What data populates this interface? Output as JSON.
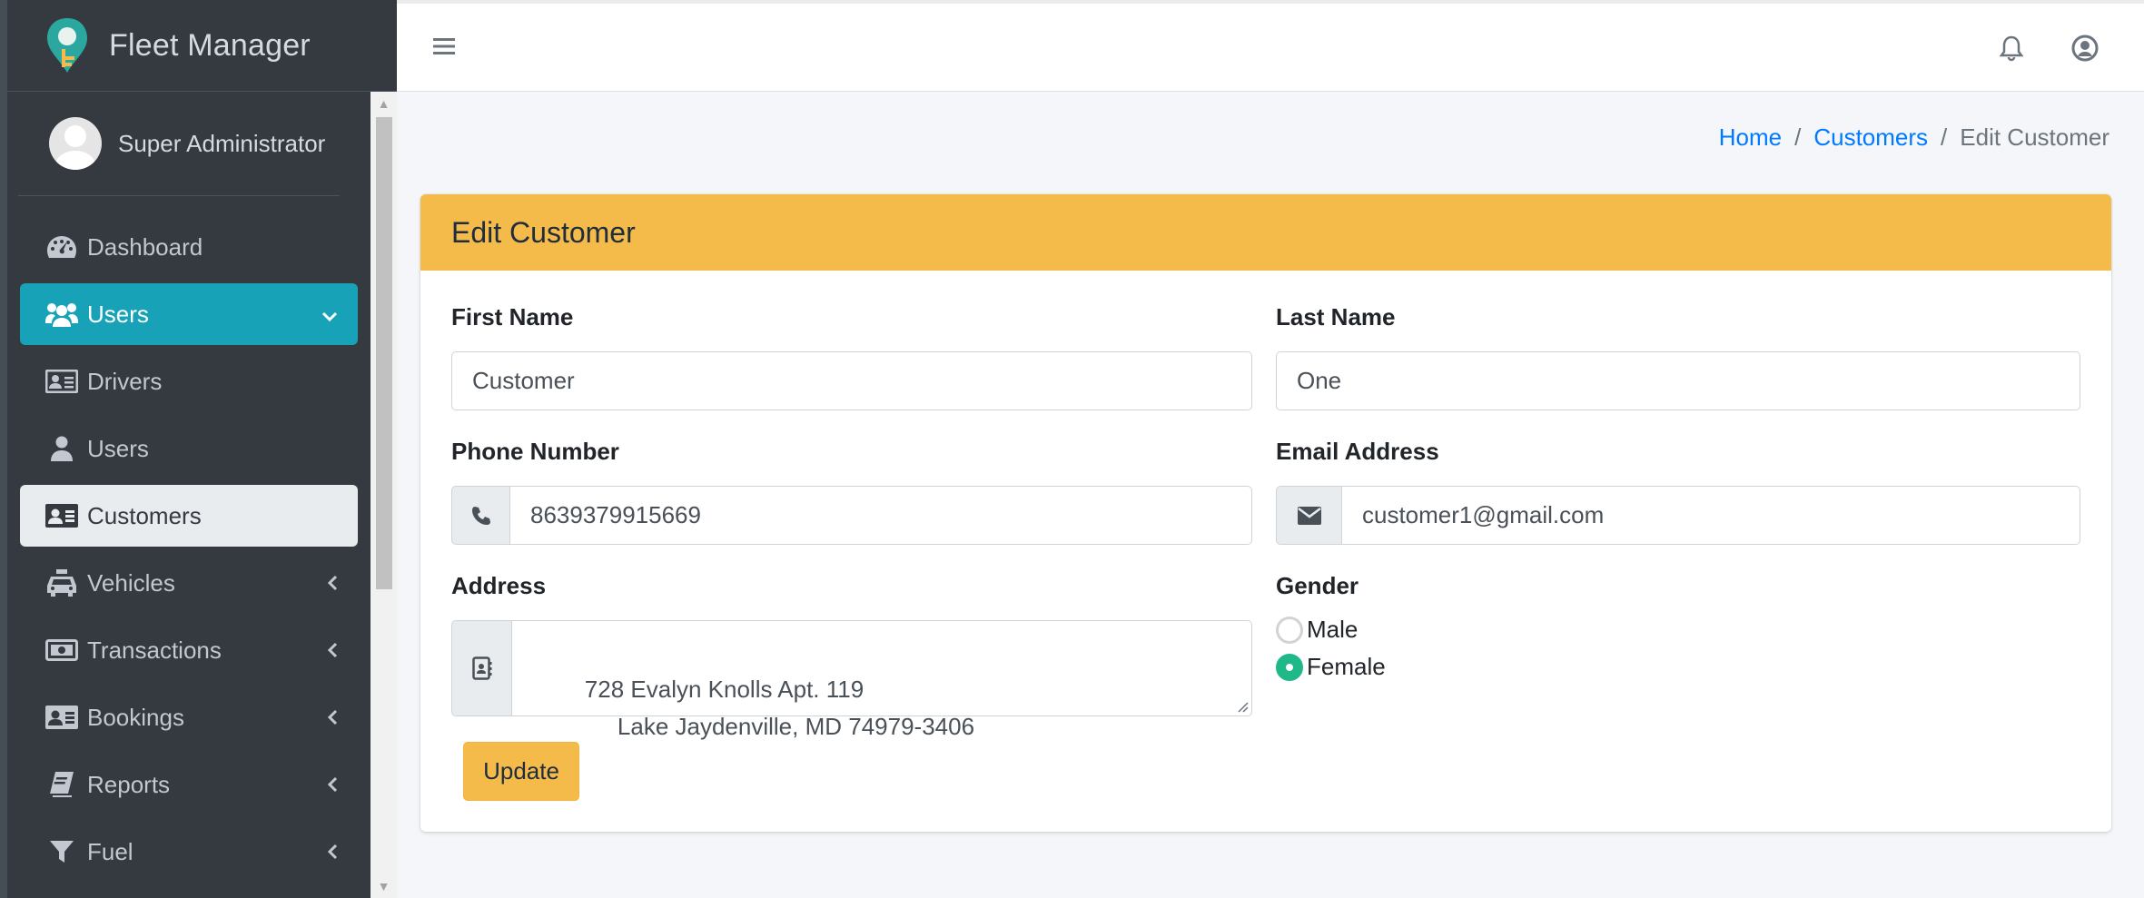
{
  "brand": {
    "title": "Fleet Manager"
  },
  "user_panel": {
    "name": "Super Administrator"
  },
  "sidebar": {
    "items": [
      {
        "label": "Dashboard",
        "icon": "dashboard-icon"
      },
      {
        "label": "Users",
        "icon": "users-icon",
        "state": "active",
        "chevron": "down"
      },
      {
        "label": "Drivers",
        "icon": "id-card-icon"
      },
      {
        "label": "Users",
        "icon": "user-icon"
      },
      {
        "label": "Customers",
        "icon": "address-card-icon",
        "state": "selected"
      },
      {
        "label": "Vehicles",
        "icon": "taxi-icon",
        "chevron": "left"
      },
      {
        "label": "Transactions",
        "icon": "money-bill-icon",
        "chevron": "left"
      },
      {
        "label": "Bookings",
        "icon": "address-card-icon",
        "chevron": "left"
      },
      {
        "label": "Reports",
        "icon": "book-icon",
        "chevron": "left"
      },
      {
        "label": "Fuel",
        "icon": "filter-icon",
        "chevron": "left"
      }
    ]
  },
  "breadcrumb": {
    "home": "Home",
    "customers": "Customers",
    "current": "Edit Customer",
    "separator": "/"
  },
  "card": {
    "title": "Edit Customer"
  },
  "form": {
    "first_name": {
      "label": "First Name",
      "value": "Customer"
    },
    "last_name": {
      "label": "Last Name",
      "value": "One"
    },
    "phone": {
      "label": "Phone Number",
      "value": "8639379915669"
    },
    "email": {
      "label": "Email Address",
      "value": "customer1@gmail.com"
    },
    "address": {
      "label": "Address",
      "value": "728 Evalyn Knolls Apt. 119\n             Lake Jaydenville, MD 74979-3406"
    },
    "gender": {
      "label": "Gender",
      "options": [
        "Male",
        "Female"
      ],
      "selected": "Female"
    },
    "submit_label": "Update"
  },
  "colors": {
    "sidebar_bg": "#343a40",
    "active_item": "#17a2b8",
    "card_header": "#f4bb4a",
    "link": "#007bff",
    "radio_checked": "#1fb889"
  }
}
